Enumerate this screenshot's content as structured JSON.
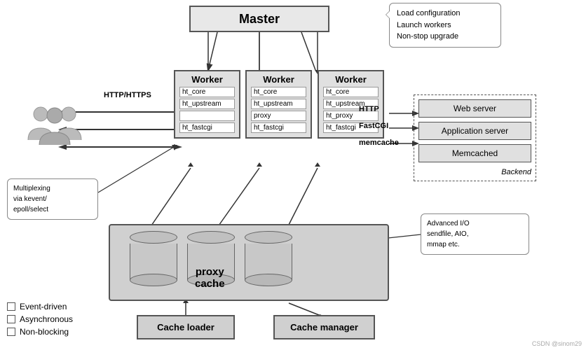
{
  "master": {
    "label": "Master",
    "bubble": {
      "line1": "Load configuration",
      "line2": "Launch workers",
      "line3": "Non-stop upgrade"
    }
  },
  "workers": [
    {
      "title": "Worker",
      "modules": [
        "ht_core",
        "ht_upstream",
        "",
        "ht_fastcgi"
      ]
    },
    {
      "title": "Worker",
      "modules": [
        "ht_core",
        "ht_upstream",
        "proxy",
        "ht_fastcgi"
      ]
    },
    {
      "title": "Worker",
      "modules": [
        "ht_core",
        "ht_upstream",
        "ht_proxy",
        "ht_fastcgi"
      ]
    }
  ],
  "http_label": "HTTP/HTTPS",
  "protocol_labels": {
    "http": "HTTP",
    "fastcgi": "FastCGI",
    "memcache": "memcache"
  },
  "backend": {
    "title": "Backend",
    "rows": [
      "Web server",
      "Application server",
      "Memcached"
    ]
  },
  "proxy_cache": {
    "label": "proxy\ncache"
  },
  "cache_loader": {
    "label": "Cache loader"
  },
  "cache_manager": {
    "label": "Cache manager"
  },
  "multiplexing": {
    "text": "Multiplexing\nvia kevent/\nepoll/select"
  },
  "advanced_io": {
    "text": "Advanced I/O\nsendfile, AIO,\nmmap etc."
  },
  "legend": {
    "items": [
      "Event-driven",
      "Asynchronous",
      "Non-blocking"
    ]
  },
  "watermark": "CSDN @sinom29"
}
